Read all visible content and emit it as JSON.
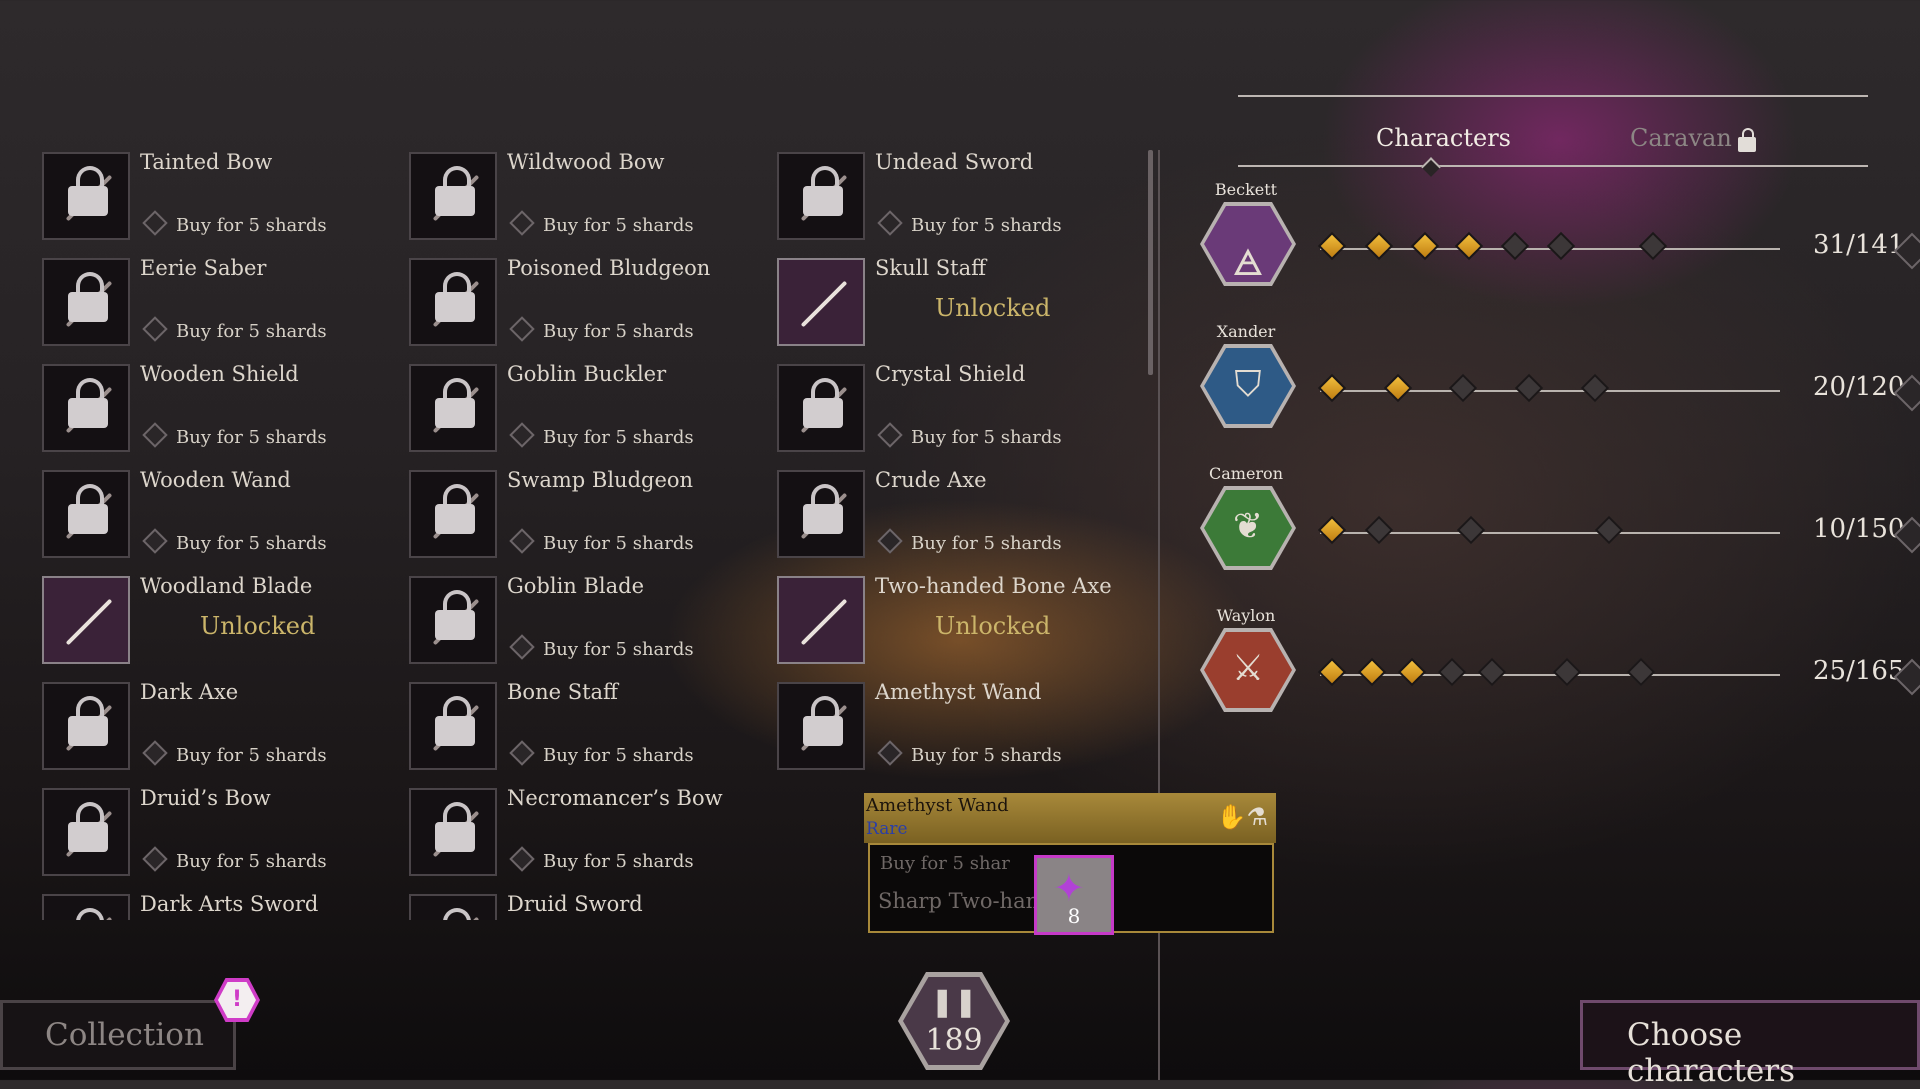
{
  "items": {
    "col1": [
      {
        "name": "Tainted Bow",
        "status": "Buy for 5 shards",
        "unlocked": false
      },
      {
        "name": "Eerie Saber",
        "status": "Buy for 5 shards",
        "unlocked": false
      },
      {
        "name": "Wooden Shield",
        "status": "Buy for 5 shards",
        "unlocked": false
      },
      {
        "name": "Wooden Wand",
        "status": "Buy for 5 shards",
        "unlocked": false
      },
      {
        "name": "Woodland Blade",
        "status": "Unlocked",
        "unlocked": true
      },
      {
        "name": "Dark Axe",
        "status": "Buy for 5 shards",
        "unlocked": false
      },
      {
        "name": "Druid’s Bow",
        "status": "Buy for 5 shards",
        "unlocked": false
      },
      {
        "name": "Dark Arts Sword",
        "status": "",
        "unlocked": false
      }
    ],
    "col2": [
      {
        "name": "Wildwood Bow",
        "status": "Buy for 5 shards",
        "unlocked": false
      },
      {
        "name": "Poisoned Bludgeon",
        "status": "Buy for 5 shards",
        "unlocked": false
      },
      {
        "name": "Goblin Buckler",
        "status": "Buy for 5 shards",
        "unlocked": false
      },
      {
        "name": "Swamp Bludgeon",
        "status": "Buy for 5 shards",
        "unlocked": false
      },
      {
        "name": "Goblin Blade",
        "status": "Buy for 5 shards",
        "unlocked": false
      },
      {
        "name": "Bone Staff",
        "status": "Buy for 5 shards",
        "unlocked": false
      },
      {
        "name": "Necromancer’s Bow",
        "status": "Buy for 5 shards",
        "unlocked": false
      },
      {
        "name": "Druid Sword",
        "status": "",
        "unlocked": false
      }
    ],
    "col3": [
      {
        "name": "Undead Sword",
        "status": "Buy for 5 shards",
        "unlocked": false
      },
      {
        "name": "Skull Staff",
        "status": "Unlocked",
        "unlocked": true
      },
      {
        "name": "Crystal Shield",
        "status": "Buy for 5 shards",
        "unlocked": false
      },
      {
        "name": "Crude Axe",
        "status": "Buy for 5 shards",
        "unlocked": false
      },
      {
        "name": "Two-handed Bone Axe",
        "status": "Unlocked",
        "unlocked": true
      },
      {
        "name": "Amethyst Wand",
        "status": "Buy for 5 shards",
        "unlocked": false
      }
    ]
  },
  "tooltip": {
    "title": "Amethyst Wand",
    "rarity": "Rare",
    "icons": "✋⚗",
    "hidden_price": "Buy for 5 shar",
    "hidden_next": "Sharp Two-han",
    "count": "8"
  },
  "tabs": {
    "characters": "Characters",
    "caravan": "Caravan"
  },
  "characters": [
    {
      "name": "Beckett",
      "progress": "31/141",
      "color": "#6a3a78",
      "glyph": "🜁",
      "nodes": [
        1,
        1,
        1,
        1,
        0,
        0,
        0
      ],
      "positions": [
        0,
        47,
        93,
        137,
        183,
        229,
        321
      ]
    },
    {
      "name": "Xander",
      "progress": "20/120",
      "color": "#2e5a86",
      "glyph": "⛉",
      "nodes": [
        1,
        1,
        0,
        0,
        0
      ],
      "positions": [
        0,
        66,
        131,
        197,
        263
      ]
    },
    {
      "name": "Cameron",
      "progress": "10/150",
      "color": "#3c7a38",
      "glyph": "❦",
      "nodes": [
        1,
        0,
        0,
        0
      ],
      "positions": [
        0,
        47,
        139,
        277
      ]
    },
    {
      "name": "Waylon",
      "progress": "25/165",
      "color": "#9a3e2e",
      "glyph": "⚔",
      "nodes": [
        1,
        1,
        1,
        0,
        0,
        0,
        0
      ],
      "positions": [
        0,
        40,
        80,
        120,
        160,
        235,
        309
      ]
    }
  ],
  "buttons": {
    "collection": "Collection",
    "choose": "Choose characters",
    "warning": "!"
  },
  "shards": {
    "value": "189",
    "icon": "shard-icon"
  },
  "colors": {
    "gold": "#cbb56a",
    "accent": "#cf3cc7",
    "node_filled": "#e6a62a"
  }
}
